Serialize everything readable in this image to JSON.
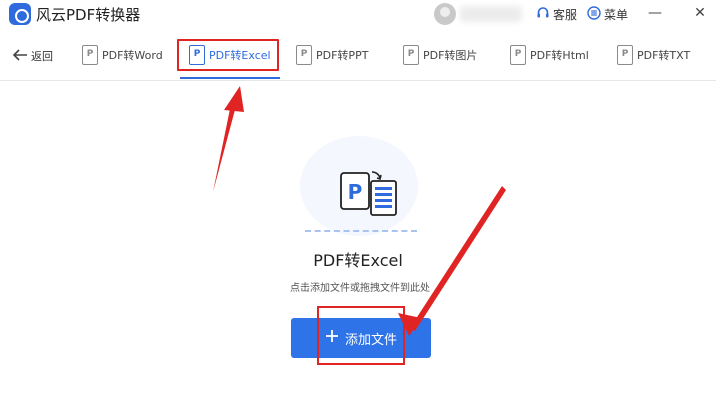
{
  "app": {
    "title": "风云PDF转换器",
    "logo_icon": "app-logo-icon"
  },
  "titlebar": {
    "service_label": "客服",
    "menu_label": "菜单",
    "minimize_glyph": "—",
    "close_glyph": "✕",
    "service_icon": "headset-icon",
    "menu_icon": "menu-icon"
  },
  "toolbar": {
    "back_label": "返回",
    "back_icon": "arrow-left-icon",
    "tabs": [
      {
        "label": "PDF转Word",
        "icon": "P"
      },
      {
        "label": "PDF转Excel",
        "icon": "P",
        "active": true
      },
      {
        "label": "PDF转PPT",
        "icon": "P"
      },
      {
        "label": "PDF转图片",
        "icon": "P"
      },
      {
        "label": "PDF转Html",
        "icon": "P"
      },
      {
        "label": "PDF转TXT",
        "icon": "P"
      }
    ]
  },
  "main": {
    "hero_icon": "pdf-to-excel-icon",
    "hero_icon_letter": "P",
    "title": "PDF转Excel",
    "hint": "点击添加文件或拖拽文件到此处",
    "add_button_label": "添加文件",
    "add_button_icon": "plus-icon"
  },
  "colors": {
    "accent": "#2f6bdc",
    "button": "#2f73e8",
    "annotation": "#e02424"
  }
}
